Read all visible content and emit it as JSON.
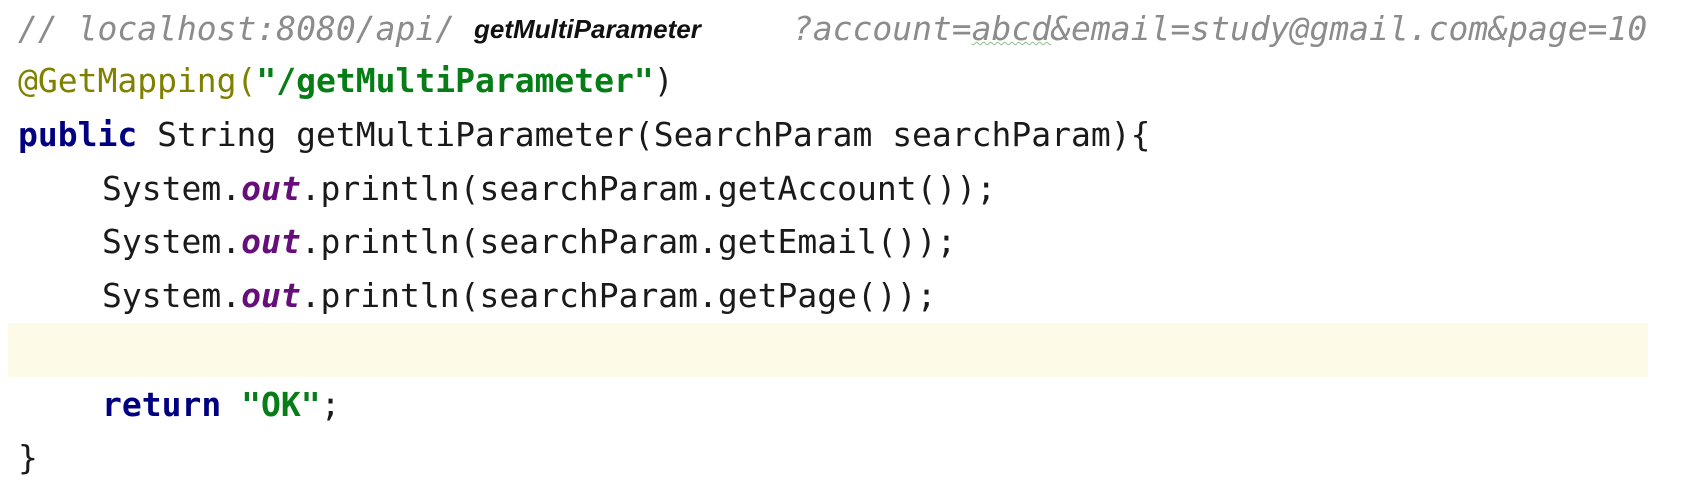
{
  "editor": {
    "comment_line": {
      "prefix": "// localhost:8080/api/",
      "after_tooltip": "?account=",
      "typo_word": "abcd",
      "rest": "&email=study@gmail.com&page=10"
    },
    "tooltip": "getMultiParameter",
    "annotation_line": {
      "annotation": "@GetMapping(",
      "path_string": "\"/getMultiParameter\"",
      "close": ")"
    },
    "signature_line": {
      "keyword": "public",
      "text": " String getMultiParameter(SearchParam searchParam){"
    },
    "print_lines": [
      {
        "prefix": "System.",
        "field": "out",
        "call": ".println(searchParam.getAccount());"
      },
      {
        "prefix": "System.",
        "field": "out",
        "call": ".println(searchParam.getEmail());"
      },
      {
        "prefix": "System.",
        "field": "out",
        "call": ".println(searchParam.getPage());"
      }
    ],
    "return_line": {
      "keyword": "return",
      "value": "\"OK\"",
      "end": ";"
    },
    "closing_brace": "}"
  },
  "colors": {
    "comment": "#8c8c8c",
    "annotation": "#808000",
    "string": "#067d17",
    "keyword": "#000080",
    "static_field": "#660e7a",
    "current_line_highlight": "#fdfbe8"
  }
}
